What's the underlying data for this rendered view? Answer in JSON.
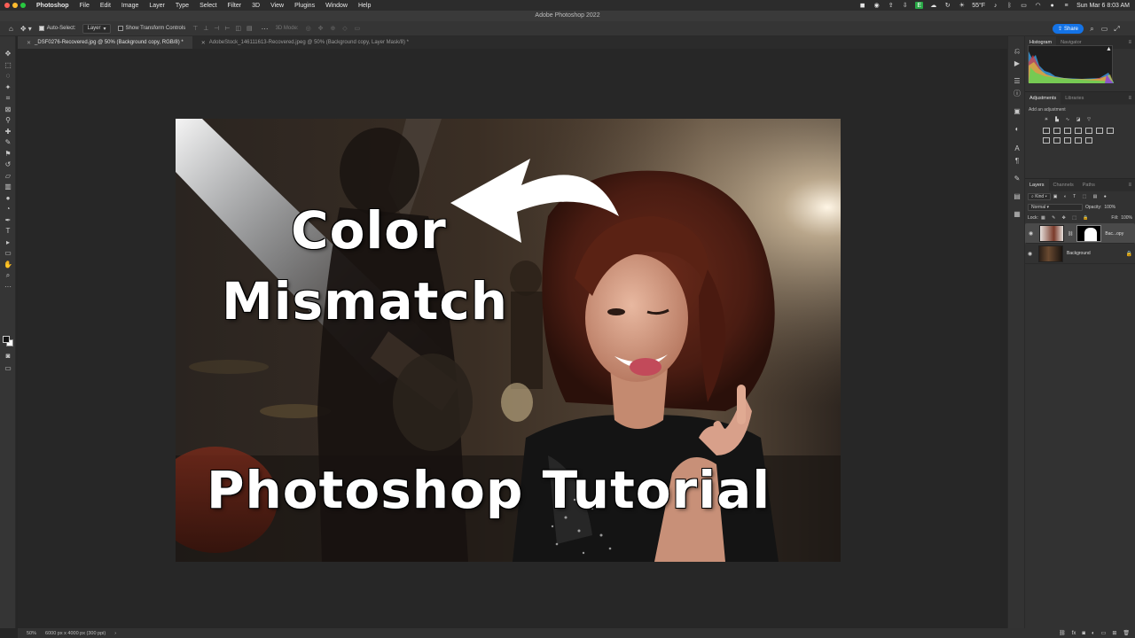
{
  "menubar": {
    "app": "Photoshop",
    "items": [
      "File",
      "Edit",
      "Image",
      "Layer",
      "Type",
      "Select",
      "Filter",
      "3D",
      "View",
      "Plugins",
      "Window",
      "Help"
    ],
    "weather": "55°F",
    "datetime": "Sun Mar 6  8:03 AM"
  },
  "window": {
    "title": "Adobe Photoshop 2022"
  },
  "options": {
    "auto_select_label": "Auto-Select:",
    "auto_select_value": "Layer",
    "transform_label": "Show Transform Controls",
    "mode_3d": "3D Mode:",
    "share_label": "Share"
  },
  "tabs": [
    {
      "label": "_DSF0276-Recovered.jpg @ 50% (Background copy, RGB/8) *",
      "active": true
    },
    {
      "label": "AdobeStock_146111613-Recovered.jpeg @ 50% (Background copy, Layer Mask/8) *",
      "active": false
    }
  ],
  "canvas": {
    "line1": "Color",
    "line2": "Mismatch",
    "line3": "Photoshop Tutorial"
  },
  "panels": {
    "histogram_tabs": [
      "Histogram",
      "Navigator"
    ],
    "adjust_tabs": [
      "Adjustments",
      "Libraries"
    ],
    "adjust_label": "Add an adjustment",
    "layers_tabs": [
      "Layers",
      "Channels",
      "Paths"
    ],
    "kind_label": "Kind",
    "blend_mode": "Normal",
    "opacity_label": "Opacity:",
    "opacity_value": "100%",
    "lock_label": "Lock:",
    "fill_label": "Fill:",
    "fill_value": "100%",
    "layers": [
      {
        "name": "Bac...opy",
        "selected": true
      },
      {
        "name": "Background",
        "selected": false
      }
    ]
  },
  "statusbar": {
    "zoom": "50%",
    "doc_info": "6000 px x 4000 px (300 ppi)"
  },
  "colors": {
    "accent": "#1473e6",
    "menubar_bg": "#2c2c2c",
    "panel_bg": "#323232"
  }
}
